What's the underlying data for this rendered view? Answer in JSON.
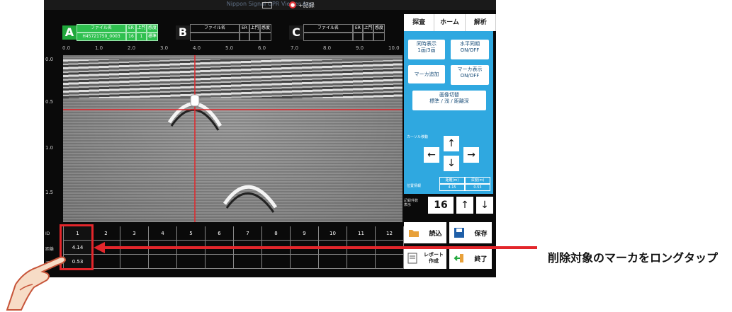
{
  "window": {
    "title": "Nippon Signal GPR Viewer App",
    "record_icon": "record-icon",
    "record_label": "+記録"
  },
  "files": {
    "headers": [
      "ファイル名",
      "ER",
      "上門",
      "感度"
    ],
    "a": {
      "letter": "A",
      "filename": "H45721750_0003",
      "er": "16",
      "gate": "1",
      "sens": "標準"
    },
    "b": {
      "letter": "B"
    },
    "c": {
      "letter": "C"
    }
  },
  "x_ticks": [
    "0.0",
    "1.0",
    "2.0",
    "3.0",
    "4.0",
    "5.0",
    "6.0",
    "7.0",
    "8.0",
    "9.0",
    "10.0"
  ],
  "y_ticks": [
    "0.0",
    "0.5",
    "1.0",
    "1.5"
  ],
  "markers": {
    "row_labels": [
      "ID",
      "距離",
      "深さ"
    ],
    "ids": [
      "1",
      "2",
      "3",
      "4",
      "5",
      "6",
      "7",
      "8",
      "9",
      "10",
      "11",
      "12"
    ],
    "distance": "4.14",
    "depth": "0.53"
  },
  "tabs": [
    "探査",
    "ホーム",
    "解析"
  ],
  "controls": {
    "sync": "同時表示\n1画/3画",
    "hsync": "水平同期\nON/OFF",
    "add_marker": "マーカ追加",
    "show_marker": "マーカ表示\nON/OFF",
    "image_switch": "画像切替\n標準 / 浅 / 距離深",
    "keypad_label": "カーソル移動",
    "arrows": {
      "up": "↑",
      "down": "↓",
      "left": "←",
      "right": "→"
    },
    "pos_label": "位置情報",
    "pos_headers": [
      "距離(m)",
      "深度(m)"
    ],
    "pos_values": [
      "4.15",
      "0.53"
    ]
  },
  "count": {
    "label": "記録件数\n表示",
    "value": "16",
    "up": "↑",
    "down": "↓"
  },
  "buttons": {
    "load": "読込",
    "save": "保存",
    "report": "レポート\n作成",
    "exit": "終了"
  },
  "annotation": {
    "note": "削除対象のマーカをロングタップ"
  },
  "colors": {
    "accent": "#2fa8e0",
    "file_a": "#21a83c",
    "highlight": "#e3262b"
  }
}
